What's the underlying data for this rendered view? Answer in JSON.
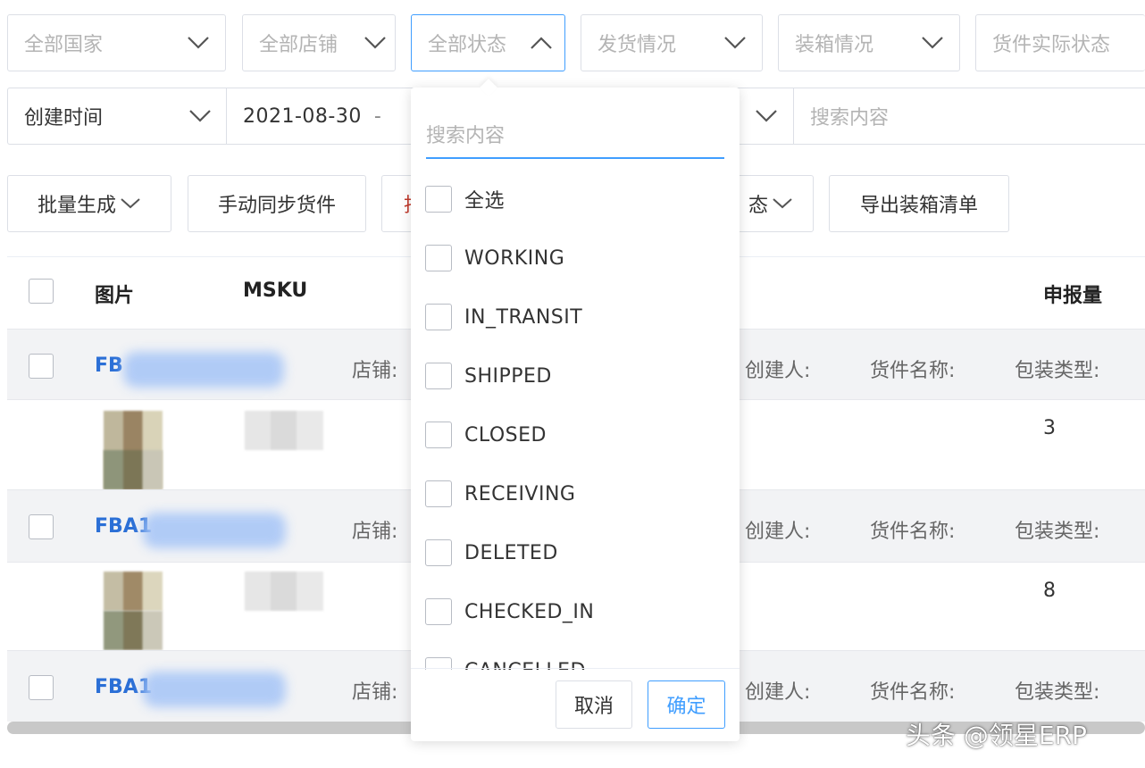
{
  "filters_row1": {
    "country": "全部国家",
    "store": "全部店铺",
    "status": "全部状态",
    "shipping": "发货情况",
    "packing": "装箱情况",
    "actual_status": "货件实际状态"
  },
  "filters_row2": {
    "date_type": "创建时间",
    "date_start": "2021-08-30",
    "date_sep": "-",
    "search_placeholder": "搜索内容"
  },
  "toolbar": {
    "batch_generate": "批量生成",
    "manual_sync": "手动同步货件",
    "hidden_partial_left": "批",
    "hidden_partial_right": "态",
    "export_packing": "导出装箱清单"
  },
  "table": {
    "headers": {
      "image": "图片",
      "msku": "MSKU",
      "declared_qty": "申报量"
    },
    "groups": [
      {
        "shipment_id": "FB",
        "store_label": "店铺:",
        "creator_label": "创建人:",
        "name_label": "货件名称:",
        "pack_label": "包装类型:",
        "declared_qty": "3"
      },
      {
        "shipment_id": "FBA1",
        "store_label": "店铺:",
        "creator_label": "创建人:",
        "name_label": "货件名称:",
        "pack_label": "包装类型:",
        "declared_qty": "8"
      },
      {
        "shipment_id": "FBA1",
        "store_label": "店铺:",
        "creator_label": "创建人:",
        "name_label": "货件名称:",
        "pack_label": "包装类型:"
      }
    ]
  },
  "status_dropdown": {
    "search_placeholder": "搜索内容",
    "select_all": "全选",
    "options": [
      "WORKING",
      "IN_TRANSIT",
      "SHIPPED",
      "CLOSED",
      "RECEIVING",
      "DELETED",
      "CHECKED_IN",
      "CANCELLED"
    ],
    "cancel": "取消",
    "confirm": "确定"
  },
  "watermark": "头条 @领星ERP",
  "colors": {
    "accent": "#409eff",
    "link": "#2b6fd6",
    "row_grey": "#f2f3f5"
  }
}
